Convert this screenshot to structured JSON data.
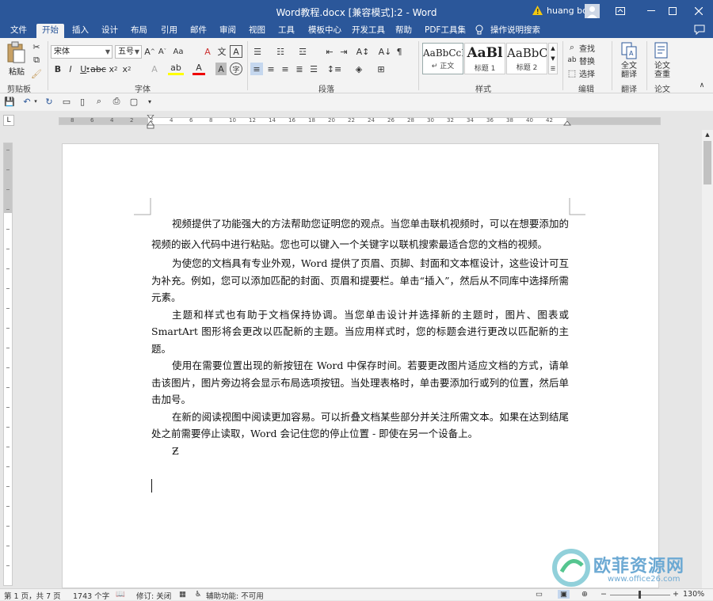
{
  "window": {
    "title": "Word教程.docx [兼容模式]:2  -  Word",
    "user": "huang bo",
    "warning_icon": "warning-icon",
    "colors": {
      "titlebar": "#2b579a",
      "ribbon": "#f3f3f3",
      "accent": "#2b579a"
    }
  },
  "menu": {
    "tabs": [
      "文件",
      "开始",
      "插入",
      "设计",
      "布局",
      "引用",
      "邮件",
      "审阅",
      "视图",
      "工具",
      "模板中心",
      "开发工具",
      "帮助",
      "PDF工具集"
    ],
    "active": "开始",
    "tell_me": "操作说明搜索"
  },
  "ribbon": {
    "clipboard": {
      "paste": "粘贴",
      "label": "剪贴板"
    },
    "font": {
      "name": "宋体",
      "size": "五号",
      "label": "字体"
    },
    "paragraph": {
      "label": "段落"
    },
    "styles": {
      "label": "样式",
      "items": [
        {
          "preview": "AaBbCcI",
          "name": "↵ 正文"
        },
        {
          "preview": "AaBl",
          "name": "标题 1"
        },
        {
          "preview": "AaBbC",
          "name": "标题 2"
        }
      ]
    },
    "editing": {
      "find": "查找",
      "replace": "替换",
      "select": "选择",
      "label": "编辑"
    },
    "translate": {
      "button": "全文翻译",
      "label": "翻译"
    },
    "paper": {
      "button": "论文查重",
      "label": "论文"
    }
  },
  "ruler": {
    "h_labels": [
      "8",
      "6",
      "4",
      "2",
      "2",
      "4",
      "6",
      "8",
      "10",
      "12",
      "14",
      "16",
      "18",
      "20",
      "22",
      "24",
      "26",
      "28",
      "30",
      "32",
      "34",
      "36",
      "38",
      "40",
      "42"
    ]
  },
  "document": {
    "paragraphs": [
      "视频提供了功能强大的方法帮助您证明您的观点。当您单击联机视频时，可以在想要添加的视频的嵌入代码中进行粘贴。您也可以键入一个关键字以联机搜索最适合您的文档的视频。",
      "为使您的文档具有专业外观，Word 提供了页眉、页脚、封面和文本框设计，这些设计可互为补充。例如，您可以添加匹配的封面、页眉和提要栏。单击“插入”，然后从不同库中选择所需元素。",
      "主题和样式也有助于文档保持协调。当您单击设计并选择新的主题时，图片、图表或 SmartArt 图形将会更改以匹配新的主题。当应用样式时，您的标题会进行更改以匹配新的主题。",
      "使用在需要位置出现的新按钮在 Word 中保存时间。若要更改图片适应文档的方式，请单击该图片，图片旁边将会显示布局选项按钮。当处理表格时，单击要添加行或列的位置，然后单击加号。",
      "在新的阅读视图中阅读更加容易。可以折叠文档某些部分并关注所需文本。如果在达到结尾处之前需要停止读取，Word 会记住您的停止位置 - 即使在另一个设备上。",
      "Ƶ"
    ]
  },
  "status": {
    "page": "第 1 页，共 7 页",
    "words": "1743 个字",
    "track": "修订: 关闭",
    "accessibility": "辅助功能: 不可用",
    "zoom": "130%"
  },
  "watermark": {
    "text": "欧菲资源网",
    "url": "www.office26.com"
  }
}
